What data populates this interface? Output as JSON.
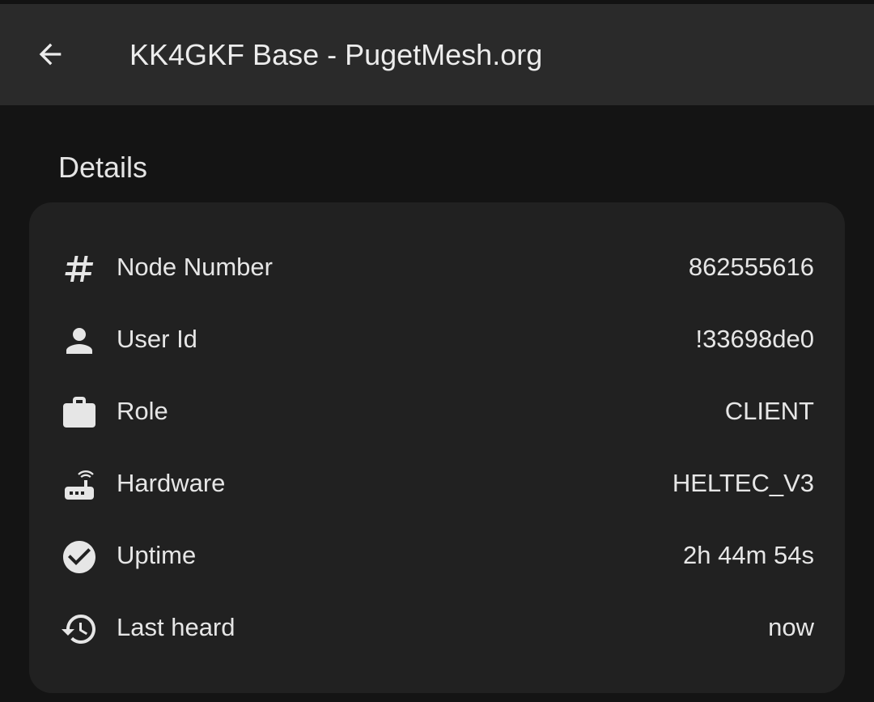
{
  "app_bar": {
    "title": "KK4GKF Base - PugetMesh.org",
    "back_icon": "arrow-back-icon"
  },
  "section": {
    "title": "Details"
  },
  "details": [
    {
      "icon": "hash-icon",
      "label": "Node Number",
      "value": "862555616"
    },
    {
      "icon": "person-icon",
      "label": "User Id",
      "value": "!33698de0"
    },
    {
      "icon": "briefcase-icon",
      "label": "Role",
      "value": "CLIENT"
    },
    {
      "icon": "router-icon",
      "label": "Hardware",
      "value": "HELTEC_V3"
    },
    {
      "icon": "check-circle-icon",
      "label": "Uptime",
      "value": "2h 44m 54s"
    },
    {
      "icon": "history-icon",
      "label": "Last heard",
      "value": "now"
    }
  ],
  "colors": {
    "background": "#141414",
    "app_bar": "#2a2a2a",
    "card": "#212121",
    "text": "#e6e6e6"
  }
}
